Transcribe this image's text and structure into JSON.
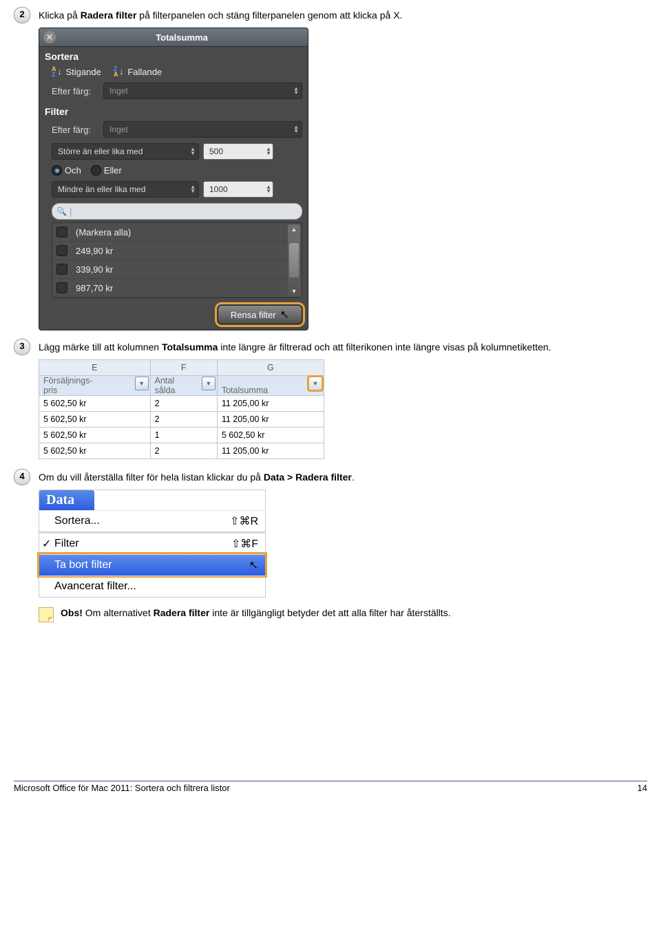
{
  "step2": {
    "pre": "Klicka på ",
    "bold": "Radera filter",
    "post": " på filterpanelen och stäng filterpanelen genom att klicka på X."
  },
  "panel": {
    "title": "Totalsumma",
    "close": "✕",
    "sort_section": "Sortera",
    "ascending": "Stigande",
    "descending": "Fallande",
    "by_color": "Efter färg:",
    "none": "Inget",
    "filter_section": "Filter",
    "gte": "Större än eller lika med",
    "gte_val": "500",
    "and": "Och",
    "or": "Eller",
    "lte": "Mindre än eller lika med",
    "lte_val": "1000",
    "select_all": "(Markera alla)",
    "items": [
      "249,90 kr",
      "339,90 kr",
      "987,70 kr"
    ],
    "clear": "Rensa filter"
  },
  "step3": {
    "pre": "Lägg märke till att kolumnen ",
    "bold": "Totalsumma",
    "post": " inte längre är filtrerad och att filterikonen inte längre visas på kolumnetiketten."
  },
  "table": {
    "cols": [
      "E",
      "F",
      "G"
    ],
    "hdr_price1": "Försäljnings-",
    "hdr_price2": "pris",
    "hdr_qty1": "Antal",
    "hdr_qty2": "sålda",
    "hdr_total": "Totalsumma",
    "rows": [
      [
        "5 602,50 kr",
        "2",
        "11 205,00 kr"
      ],
      [
        "5 602,50 kr",
        "2",
        "11 205,00 kr"
      ],
      [
        "5 602,50 kr",
        "1",
        "5 602,50 kr"
      ],
      [
        "5 602,50 kr",
        "2",
        "11 205,00 kr"
      ]
    ]
  },
  "step4": {
    "pre": "Om du vill återställa filter för hela listan klickar du på ",
    "bold": "Data > Radera filter",
    "post": "."
  },
  "menu": {
    "title": "Data",
    "sort": "Sortera...",
    "sort_sc": "⇧⌘R",
    "filter": "Filter",
    "filter_sc": "⇧⌘F",
    "remove": "Ta bort filter",
    "advanced": "Avancerat filter..."
  },
  "note": {
    "lead": "Obs! ",
    "pre": "Om alternativet ",
    "bold": "Radera filter",
    "post": " inte är tillgängligt betyder det att alla filter har återställts."
  },
  "footer": {
    "doc": "Microsoft Office för Mac 2011: Sortera och filtrera listor",
    "page": "14"
  }
}
